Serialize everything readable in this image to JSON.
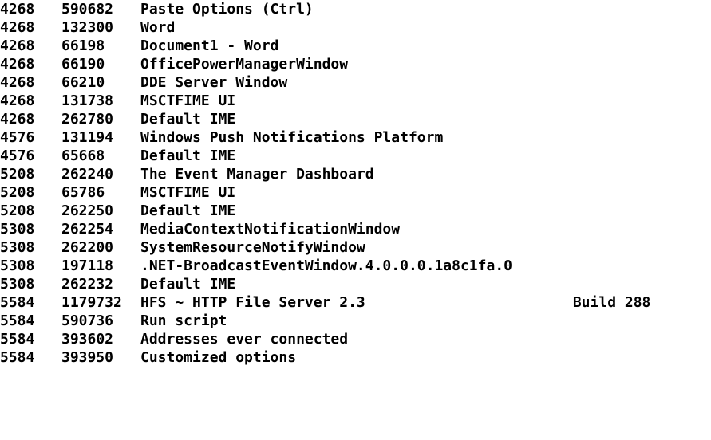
{
  "rows": [
    {
      "pid": "4268",
      "hwnd": "590682",
      "title": "Paste Options (Ctrl)"
    },
    {
      "pid": "4268",
      "hwnd": "132300",
      "title": "Word"
    },
    {
      "pid": "4268",
      "hwnd": "66198",
      "title": "Document1 - Word"
    },
    {
      "pid": "4268",
      "hwnd": "66190",
      "title": "OfficePowerManagerWindow"
    },
    {
      "pid": "4268",
      "hwnd": "66210",
      "title": "DDE Server Window"
    },
    {
      "pid": "4268",
      "hwnd": "131738",
      "title": "MSCTFIME UI"
    },
    {
      "pid": "4268",
      "hwnd": "262780",
      "title": "Default IME"
    },
    {
      "pid": "4576",
      "hwnd": "131194",
      "title": "Windows Push Notifications Platform"
    },
    {
      "pid": "4576",
      "hwnd": "65668",
      "title": "Default IME"
    },
    {
      "pid": "5208",
      "hwnd": "262240",
      "title": "The Event Manager Dashboard"
    },
    {
      "pid": "5208",
      "hwnd": "65786",
      "title": "MSCTFIME UI"
    },
    {
      "pid": "5208",
      "hwnd": "262250",
      "title": "Default IME"
    },
    {
      "pid": "5308",
      "hwnd": "262254",
      "title": "MediaContextNotificationWindow"
    },
    {
      "pid": "5308",
      "hwnd": "262200",
      "title": "SystemResourceNotifyWindow"
    },
    {
      "pid": "5308",
      "hwnd": "197118",
      "title": ".NET-BroadcastEventWindow.4.0.0.0.1a8c1fa.0"
    },
    {
      "pid": "5308",
      "hwnd": "262232",
      "title": "Default IME"
    },
    {
      "pid": "5584",
      "hwnd": "1179732",
      "title": "HFS ~ HTTP File Server 2.3                        Build 288"
    },
    {
      "pid": "5584",
      "hwnd": "590736",
      "title": "Run script"
    },
    {
      "pid": "5584",
      "hwnd": "393602",
      "title": "Addresses ever connected"
    },
    {
      "pid": "5584",
      "hwnd": "393950",
      "title": "Customized options"
    }
  ]
}
